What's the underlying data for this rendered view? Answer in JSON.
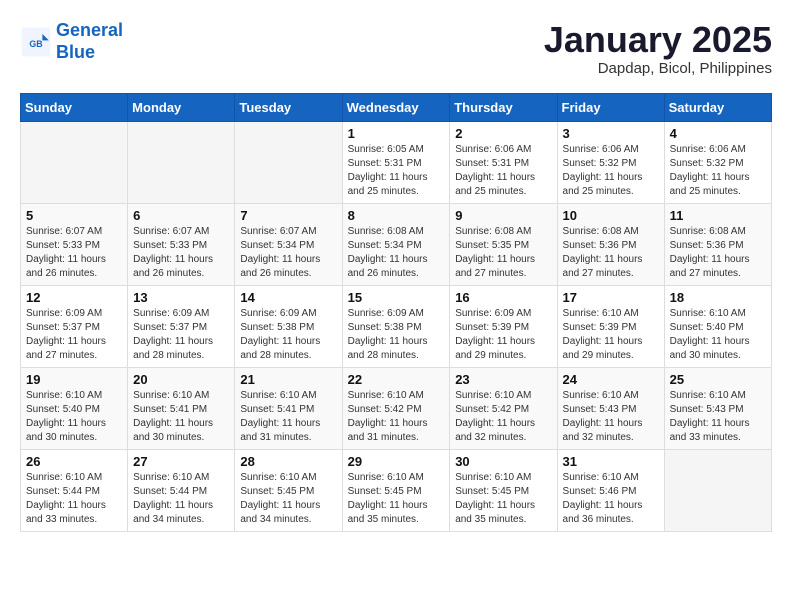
{
  "logo": {
    "line1": "General",
    "line2": "Blue"
  },
  "title": "January 2025",
  "location": "Dapdap, Bicol, Philippines",
  "weekdays": [
    "Sunday",
    "Monday",
    "Tuesday",
    "Wednesday",
    "Thursday",
    "Friday",
    "Saturday"
  ],
  "weeks": [
    [
      {
        "day": "",
        "info": ""
      },
      {
        "day": "",
        "info": ""
      },
      {
        "day": "",
        "info": ""
      },
      {
        "day": "1",
        "info": "Sunrise: 6:05 AM\nSunset: 5:31 PM\nDaylight: 11 hours\nand 25 minutes."
      },
      {
        "day": "2",
        "info": "Sunrise: 6:06 AM\nSunset: 5:31 PM\nDaylight: 11 hours\nand 25 minutes."
      },
      {
        "day": "3",
        "info": "Sunrise: 6:06 AM\nSunset: 5:32 PM\nDaylight: 11 hours\nand 25 minutes."
      },
      {
        "day": "4",
        "info": "Sunrise: 6:06 AM\nSunset: 5:32 PM\nDaylight: 11 hours\nand 25 minutes."
      }
    ],
    [
      {
        "day": "5",
        "info": "Sunrise: 6:07 AM\nSunset: 5:33 PM\nDaylight: 11 hours\nand 26 minutes."
      },
      {
        "day": "6",
        "info": "Sunrise: 6:07 AM\nSunset: 5:33 PM\nDaylight: 11 hours\nand 26 minutes."
      },
      {
        "day": "7",
        "info": "Sunrise: 6:07 AM\nSunset: 5:34 PM\nDaylight: 11 hours\nand 26 minutes."
      },
      {
        "day": "8",
        "info": "Sunrise: 6:08 AM\nSunset: 5:34 PM\nDaylight: 11 hours\nand 26 minutes."
      },
      {
        "day": "9",
        "info": "Sunrise: 6:08 AM\nSunset: 5:35 PM\nDaylight: 11 hours\nand 27 minutes."
      },
      {
        "day": "10",
        "info": "Sunrise: 6:08 AM\nSunset: 5:36 PM\nDaylight: 11 hours\nand 27 minutes."
      },
      {
        "day": "11",
        "info": "Sunrise: 6:08 AM\nSunset: 5:36 PM\nDaylight: 11 hours\nand 27 minutes."
      }
    ],
    [
      {
        "day": "12",
        "info": "Sunrise: 6:09 AM\nSunset: 5:37 PM\nDaylight: 11 hours\nand 27 minutes."
      },
      {
        "day": "13",
        "info": "Sunrise: 6:09 AM\nSunset: 5:37 PM\nDaylight: 11 hours\nand 28 minutes."
      },
      {
        "day": "14",
        "info": "Sunrise: 6:09 AM\nSunset: 5:38 PM\nDaylight: 11 hours\nand 28 minutes."
      },
      {
        "day": "15",
        "info": "Sunrise: 6:09 AM\nSunset: 5:38 PM\nDaylight: 11 hours\nand 28 minutes."
      },
      {
        "day": "16",
        "info": "Sunrise: 6:09 AM\nSunset: 5:39 PM\nDaylight: 11 hours\nand 29 minutes."
      },
      {
        "day": "17",
        "info": "Sunrise: 6:10 AM\nSunset: 5:39 PM\nDaylight: 11 hours\nand 29 minutes."
      },
      {
        "day": "18",
        "info": "Sunrise: 6:10 AM\nSunset: 5:40 PM\nDaylight: 11 hours\nand 30 minutes."
      }
    ],
    [
      {
        "day": "19",
        "info": "Sunrise: 6:10 AM\nSunset: 5:40 PM\nDaylight: 11 hours\nand 30 minutes."
      },
      {
        "day": "20",
        "info": "Sunrise: 6:10 AM\nSunset: 5:41 PM\nDaylight: 11 hours\nand 30 minutes."
      },
      {
        "day": "21",
        "info": "Sunrise: 6:10 AM\nSunset: 5:41 PM\nDaylight: 11 hours\nand 31 minutes."
      },
      {
        "day": "22",
        "info": "Sunrise: 6:10 AM\nSunset: 5:42 PM\nDaylight: 11 hours\nand 31 minutes."
      },
      {
        "day": "23",
        "info": "Sunrise: 6:10 AM\nSunset: 5:42 PM\nDaylight: 11 hours\nand 32 minutes."
      },
      {
        "day": "24",
        "info": "Sunrise: 6:10 AM\nSunset: 5:43 PM\nDaylight: 11 hours\nand 32 minutes."
      },
      {
        "day": "25",
        "info": "Sunrise: 6:10 AM\nSunset: 5:43 PM\nDaylight: 11 hours\nand 33 minutes."
      }
    ],
    [
      {
        "day": "26",
        "info": "Sunrise: 6:10 AM\nSunset: 5:44 PM\nDaylight: 11 hours\nand 33 minutes."
      },
      {
        "day": "27",
        "info": "Sunrise: 6:10 AM\nSunset: 5:44 PM\nDaylight: 11 hours\nand 34 minutes."
      },
      {
        "day": "28",
        "info": "Sunrise: 6:10 AM\nSunset: 5:45 PM\nDaylight: 11 hours\nand 34 minutes."
      },
      {
        "day": "29",
        "info": "Sunrise: 6:10 AM\nSunset: 5:45 PM\nDaylight: 11 hours\nand 35 minutes."
      },
      {
        "day": "30",
        "info": "Sunrise: 6:10 AM\nSunset: 5:45 PM\nDaylight: 11 hours\nand 35 minutes."
      },
      {
        "day": "31",
        "info": "Sunrise: 6:10 AM\nSunset: 5:46 PM\nDaylight: 11 hours\nand 36 minutes."
      },
      {
        "day": "",
        "info": ""
      }
    ]
  ]
}
